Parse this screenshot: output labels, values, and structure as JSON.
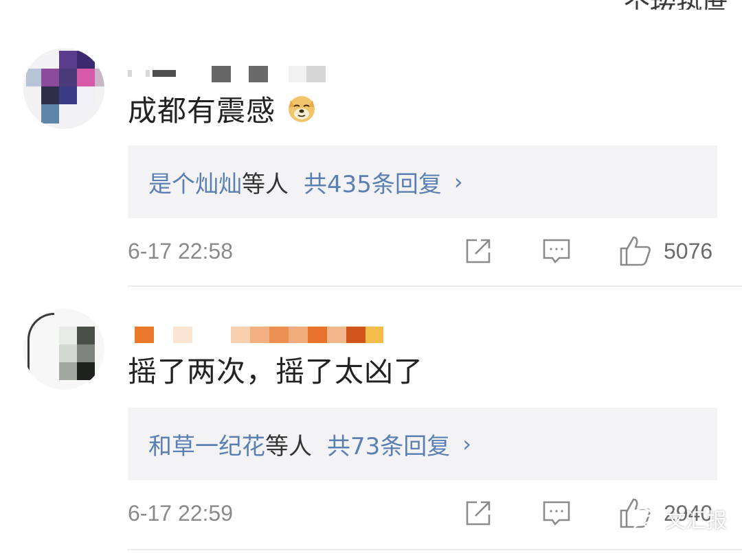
{
  "header": {
    "partial_text": "二个按热度"
  },
  "comments": [
    {
      "text": "成都有震感",
      "emoji": "doge-emoji",
      "reply_users": "是个灿灿",
      "reply_etc": "等人",
      "reply_count": "共435条回复",
      "chevron": "›",
      "timestamp": "6-17 22:58",
      "like_count": "5076"
    },
    {
      "text": "摇了两次，摇了太凶了",
      "reply_users": "和草一纪花",
      "reply_etc": "等人",
      "reply_count": "共73条回复",
      "chevron": "›",
      "timestamp": "6-17 22:59",
      "like_count": "2940"
    }
  ],
  "icons": {
    "share": "share-icon",
    "reply": "comment-icon",
    "like": "thumbs-up-icon"
  },
  "watermark": {
    "text": "文汇报"
  },
  "colors": {
    "link_blue": "#5b7fb2",
    "text": "#222222",
    "meta_gray": "#8a8a8a",
    "reply_bg": "#f3f3f5"
  }
}
